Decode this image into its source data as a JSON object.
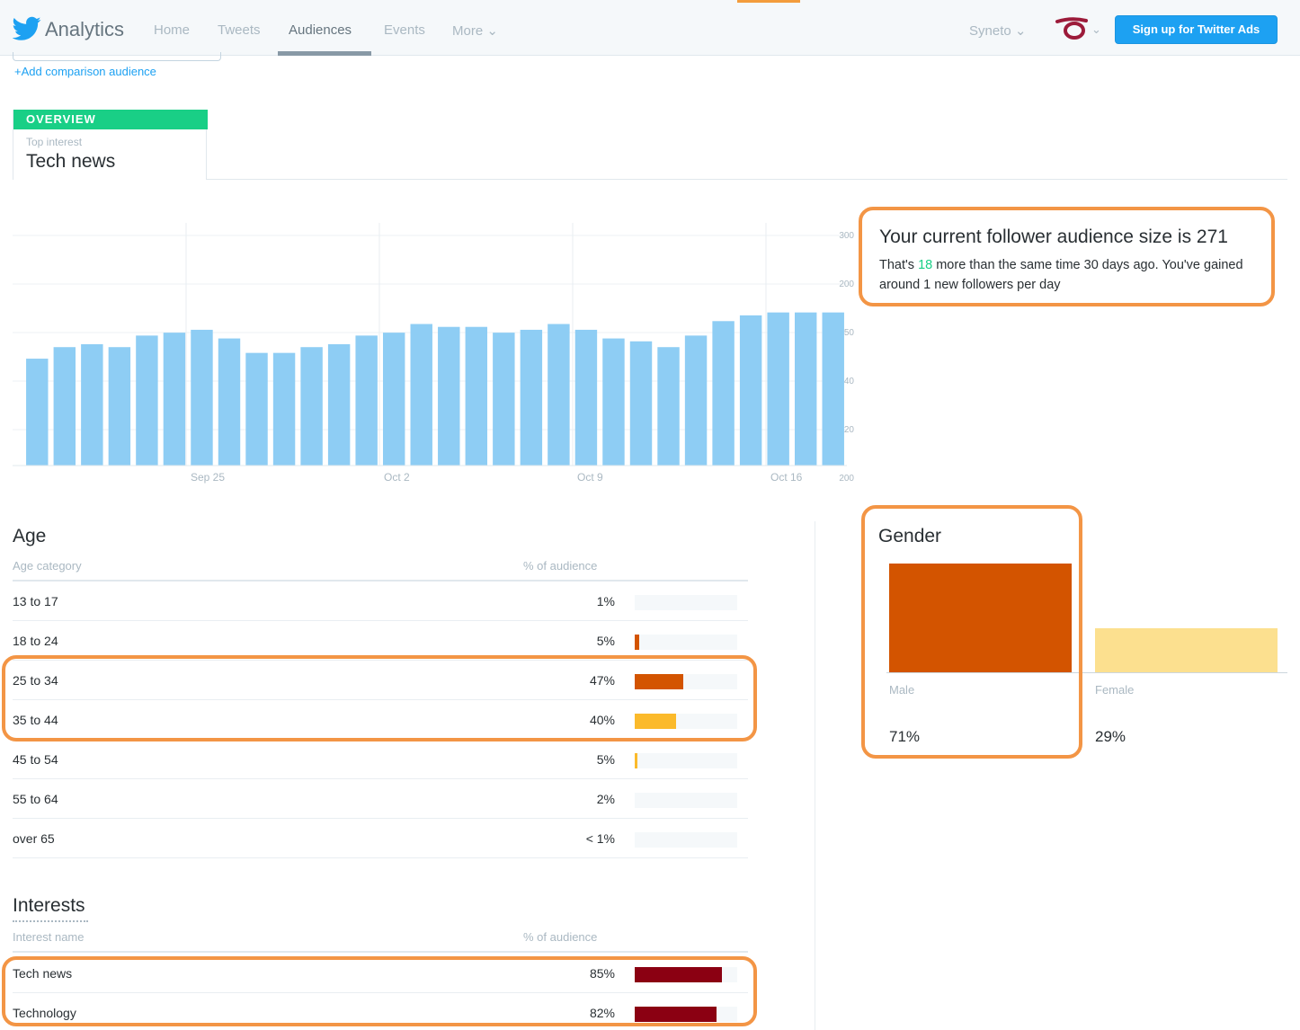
{
  "nav": {
    "brand": "Analytics",
    "items": [
      "Home",
      "Tweets",
      "Audiences",
      "Events",
      "More ⌄"
    ],
    "account": "Syneto ⌄",
    "brand_caret": "⌄",
    "ads_button": "Sign up for Twitter Ads"
  },
  "comparison": {
    "add_link": "+Add comparison audience"
  },
  "overview": {
    "tab_label": "OVERVIEW",
    "top_interest_label": "Top interest",
    "top_interest_value": "Tech news"
  },
  "summary": {
    "title": "Your current follower audience size is 271",
    "text_before": "That's ",
    "delta": "18",
    "text_after": " more than the same time 30 days ago. You've gained around 1 new followers per day"
  },
  "chart_data": {
    "type": "bar",
    "x_ticks": [
      "Sep 25",
      "Oct 2",
      "Oct 9",
      "Oct 16"
    ],
    "y_ticks": [
      "300",
      "200",
      "50",
      "40",
      "20",
      "200"
    ],
    "values": [
      255,
      259,
      260,
      259,
      263,
      264,
      265,
      262,
      257,
      257,
      259,
      260,
      263,
      264,
      267,
      266,
      266,
      264,
      265,
      267,
      265,
      262,
      261,
      259,
      263,
      268,
      270,
      271,
      271,
      271
    ],
    "ylim": [
      218,
      302
    ],
    "bar_color": "#8ecdf4"
  },
  "age": {
    "title": "Age",
    "col_category": "Age category",
    "col_pct": "% of audience",
    "rows": [
      {
        "label": "13 to 17",
        "pct": "1%",
        "fill": 0.0,
        "color": "#f5f8fa"
      },
      {
        "label": "18 to 24",
        "pct": "5%",
        "fill": 0.04,
        "color": "#d35400"
      },
      {
        "label": "25 to 34",
        "pct": "47%",
        "fill": 0.47,
        "color": "#d35400"
      },
      {
        "label": "35 to 44",
        "pct": "40%",
        "fill": 0.4,
        "color": "#fbba2b"
      },
      {
        "label": "45 to 54",
        "pct": "5%",
        "fill": 0.03,
        "color": "#fbba2b"
      },
      {
        "label": "55 to 64",
        "pct": "2%",
        "fill": 0.0,
        "color": "#f5f8fa"
      },
      {
        "label": "over 65",
        "pct": "< 1%",
        "fill": 0.0,
        "color": "#f5f8fa"
      }
    ]
  },
  "interests": {
    "title": "Interests",
    "col_name": "Interest name",
    "col_pct": "% of audience",
    "rows": [
      {
        "label": "Tech news",
        "pct": "85%",
        "fill": 0.85,
        "color": "#8b0012"
      },
      {
        "label": "Technology",
        "pct": "82%",
        "fill": 0.8,
        "color": "#8b0012"
      }
    ]
  },
  "gender": {
    "title": "Gender",
    "male_label": "Male",
    "male_pct": "71%",
    "male_value": 0.71,
    "male_color": "#d35400",
    "female_label": "Female",
    "female_pct": "29%",
    "female_value": 0.29,
    "female_color": "#fce08f"
  }
}
